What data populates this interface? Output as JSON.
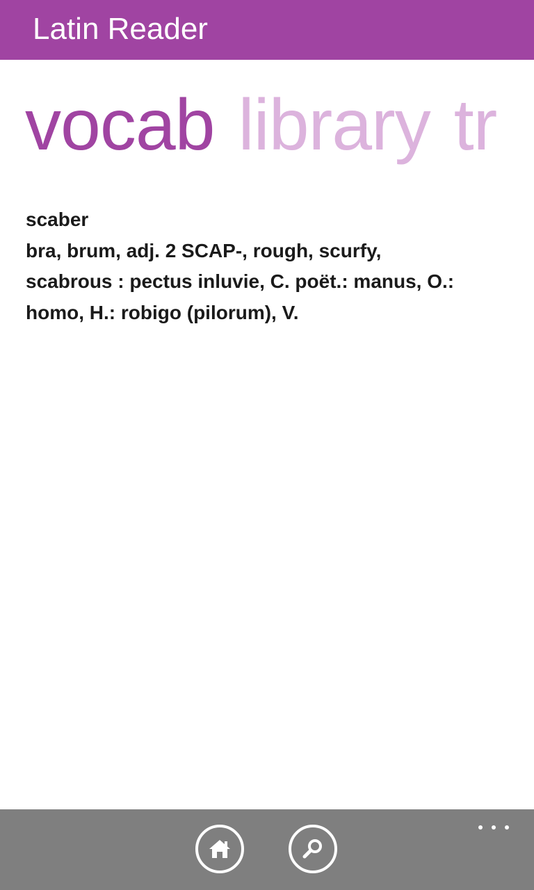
{
  "app": {
    "title": "Latin Reader",
    "accent_color": "#a044a2",
    "inactive_pivot_color": "#dcb3dd",
    "app_bar_color": "#7f7f7f"
  },
  "pivot": {
    "items": [
      {
        "label": "vocab",
        "active": true
      },
      {
        "label": "library",
        "active": false
      },
      {
        "label": "tr",
        "active": false
      }
    ]
  },
  "entry": {
    "headword": "scaber",
    "definition_lines": [
      "bra, brum, adj. 2 SCAP-, rough, scurfy,",
      "scabrous : pectus inluvie, C. poët.: manus, O.:",
      "homo, H.: robigo (pilorum), V."
    ]
  },
  "app_bar": {
    "buttons": [
      {
        "icon": "home-icon"
      },
      {
        "icon": "search-icon"
      }
    ],
    "more_icon": "more-ellipsis-icon"
  }
}
